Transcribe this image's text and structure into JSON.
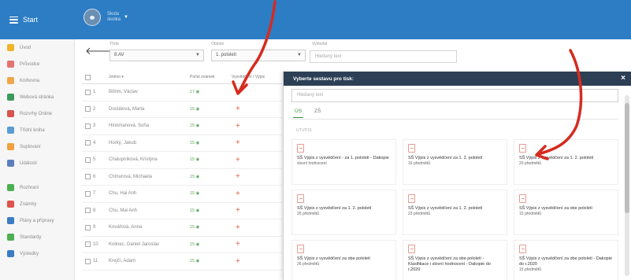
{
  "topbar": {
    "brand": "Start",
    "school_line1": "Škola",
    "school_line2": "školka"
  },
  "sidebar": {
    "items": [
      {
        "label": "Úvod",
        "color": "#f0b429"
      },
      {
        "label": "Průvodce",
        "color": "#e57373"
      },
      {
        "label": "Knihovna",
        "color": "#f0a64a"
      },
      {
        "label": "Webová stránka",
        "color": "#3a9a5b"
      },
      {
        "label": "Rozvrhy Online",
        "color": "#d9534f"
      },
      {
        "label": "Třídní kniha",
        "color": "#5b9bd5"
      },
      {
        "label": "Suplování",
        "color": "#f0a040"
      },
      {
        "label": "Události",
        "color": "#5b7fbf"
      },
      {
        "label": "Rozhraní",
        "color": "#4caf50"
      },
      {
        "label": "Známky",
        "color": "#e0534a"
      },
      {
        "label": "Plány a přípravy",
        "color": "#3b7dc4"
      },
      {
        "label": "Standardy",
        "color": "#4caf50"
      },
      {
        "label": "Výsledky",
        "color": "#3b7dc4"
      }
    ]
  },
  "filters": {
    "class_label": "Třída",
    "class_value": "8.AV",
    "period_label": "Období",
    "period_value": "1. pololetí",
    "search_label": "Vyhledat",
    "search_placeholder": "Hledaný text"
  },
  "table": {
    "headers": [
      "",
      "Jméno",
      "Počet známek",
      "Vysvědčení / Výpis"
    ],
    "rows": [
      {
        "num": "1",
        "name": "Böhm, Václav",
        "count": "17"
      },
      {
        "num": "2",
        "name": "Dostálová, Marta",
        "count": "15"
      },
      {
        "num": "3",
        "name": "Hinomanová, Soňa",
        "count": "15"
      },
      {
        "num": "4",
        "name": "Horký, Jakub",
        "count": "15"
      },
      {
        "num": "5",
        "name": "Chalupníková, Kristýna",
        "count": "15"
      },
      {
        "num": "6",
        "name": "Chmurová, Michaela",
        "count": "15"
      },
      {
        "num": "7",
        "name": "Chu, Hai Anh",
        "count": "15"
      },
      {
        "num": "8",
        "name": "Chu, Mai Anh",
        "count": "15"
      },
      {
        "num": "9",
        "name": "Kovářová, Anna",
        "count": "15"
      },
      {
        "num": "10",
        "name": "Kolinec, Daniel Jaroslav",
        "count": "15"
      },
      {
        "num": "11",
        "name": "Krejčí, Adam",
        "count": "15"
      }
    ],
    "action_glyph": "+"
  },
  "modal": {
    "title": "Vyberte sestavu pro tisk:",
    "close_glyph": "×",
    "search_placeholder": "Hledaný text",
    "tabs": [
      "ÚS",
      "ZŠ"
    ],
    "active_tab": 0,
    "section_label": "UTVPIS",
    "cards": [
      {
        "title": "SŠ Výpis z vysvědčení - za 1. pololetí - Dakopie",
        "sub": "slovní hodnocení"
      },
      {
        "title": "SŠ Výpis z vysvědčení za 1. 2. pololetí",
        "sub": "16 předmětů"
      },
      {
        "title": "SŠ Výpis z vysvědčení za 1. 2. pololetí",
        "sub": "20 předmětů"
      },
      {
        "title": "SŠ Výpis z vysvědčení za 1. 2. pololetí",
        "sub": "26 předmětů"
      },
      {
        "title": "SŠ Výpis z vysvědčení za 1. 2. pololetí",
        "sub": "23 předmětů"
      },
      {
        "title": "SŠ Výpis z vysvědčení za obe pololetí",
        "sub": "15 předmětů"
      },
      {
        "title": "SŠ Výpis z vysvědčení za obe pololetí",
        "sub": "26 předmětů"
      },
      {
        "title": "SŠ Výpis z vysvědčení za obe pololetí - Klasifikace i slovní hodnocení - Dakopie do r.2020",
        "sub": ""
      },
      {
        "title": "SŠ Výpis z vysvědčení za obe pololetí - Dakopie do r.2020",
        "sub": "15 předmětů"
      }
    ]
  },
  "colors": {
    "topbar": "#2d7dc4",
    "modal_header": "#2c3f55",
    "annotation": "#d62b1f",
    "tab_active": "#3b8f3b"
  }
}
